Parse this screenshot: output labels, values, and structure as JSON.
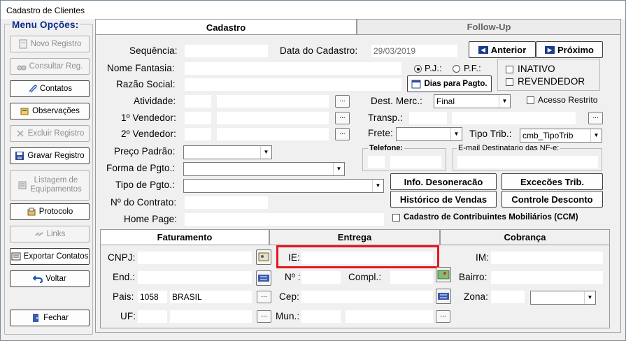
{
  "window": {
    "title": "Cadastro de Clientes"
  },
  "menu": {
    "title": "Menu Opções:",
    "items": [
      {
        "label": "Novo Registro",
        "enabled": false,
        "icon": "new-document-icon"
      },
      {
        "label": "Consultar Reg.",
        "enabled": false,
        "icon": "binoculars-icon"
      },
      {
        "label": "Contatos",
        "enabled": true,
        "icon": "paperclip-icon"
      },
      {
        "label": "Observações",
        "enabled": true,
        "icon": "notes-icon"
      },
      {
        "label": "Excluir Registro",
        "enabled": false,
        "icon": "delete-x-icon"
      },
      {
        "label": "Gravar Registro",
        "enabled": true,
        "icon": "floppy-disk-icon"
      },
      {
        "label": "Listagem de",
        "label2": "Equipamentos",
        "enabled": false,
        "icon": "list-icon"
      },
      {
        "label": "Protocolo",
        "enabled": true,
        "icon": "protocol-icon"
      },
      {
        "label": "Links",
        "enabled": false,
        "icon": "link-icon"
      },
      {
        "label": "Exportar Contatos",
        "enabled": true,
        "icon": "export-icon"
      },
      {
        "label": "Voltar",
        "enabled": true,
        "icon": "undo-arrow-icon"
      },
      {
        "label": "Fechar",
        "enabled": true,
        "icon": "door-exit-icon"
      }
    ]
  },
  "tabs": {
    "main": [
      "Cadastro",
      "Follow-Up"
    ],
    "active": "Cadastro"
  },
  "form": {
    "sequencia_label": "Sequência:",
    "sequencia": "",
    "data_label": "Data do Cadastro:",
    "data": "29/03/2019",
    "anterior": "Anterior",
    "proximo": "Próximo",
    "nome_fantasia_label": "Nome Fantasia:",
    "nome_fantasia": "",
    "razao_social_label": "Razão Social:",
    "razao_social": "",
    "pj_label": "P.J.:",
    "pf_label": "P.F.:",
    "pessoa": "P.J.",
    "inativo": "INATIVO",
    "revendedor": "REVENDEDOR",
    "dias_pagto": "Dias para Pagto.",
    "atividade_label": "Atividade:",
    "dest_merc_label": "Dest. Merc.:",
    "dest_merc": "Final",
    "acesso_restrito": "Acesso Restrito",
    "vendedor1_label": "1º Vendedor:",
    "transp_label": "Transp.:",
    "vendedor2_label": "2º Vendedor:",
    "frete_label": "Frete:",
    "frete": "",
    "tipo_trib_label": "Tipo Trib.:",
    "tipo_trib": "cmb_TipoTrib",
    "preco_label": "Preço Padrão:",
    "preco": "",
    "telefone_label": "Telefone:",
    "email_label": "E-mail Destinatario das NF-e:",
    "forma_pgto_label": "Forma de Pgto.:",
    "forma_pgto": "",
    "tipo_pgto_label": "Tipo de Pgto.:",
    "tipo_pgto": "",
    "info_deson": "Info. Desoneracão",
    "excecoes": "Excecões Trib.",
    "historico": "Histórico de Vendas",
    "controle": "Controle Desconto",
    "contrato_label": "Nº do Contrato:",
    "homepage_label": "Home Page:",
    "ccm": "Cadastro de Contribuintes Mobiliários (CCM)",
    "ellipsis": "..."
  },
  "subtabs": [
    "Faturamento",
    "Entrega",
    "Cobrança"
  ],
  "address": {
    "cnpj_label": "CNPJ:",
    "ie_label": "IE:",
    "im_label": "IM:",
    "end_label": "End.:",
    "numero_label": "Nº :",
    "compl_label": "Compl.:",
    "bairro_label": "Bairro:",
    "pais_label": "Pais:",
    "pais_code": "1058",
    "pais_name": "BRASIL",
    "cep_label": "Cep:",
    "zona_label": "Zona:",
    "zona": "",
    "uf_label": "UF:",
    "mun_label": "Mun.:"
  }
}
